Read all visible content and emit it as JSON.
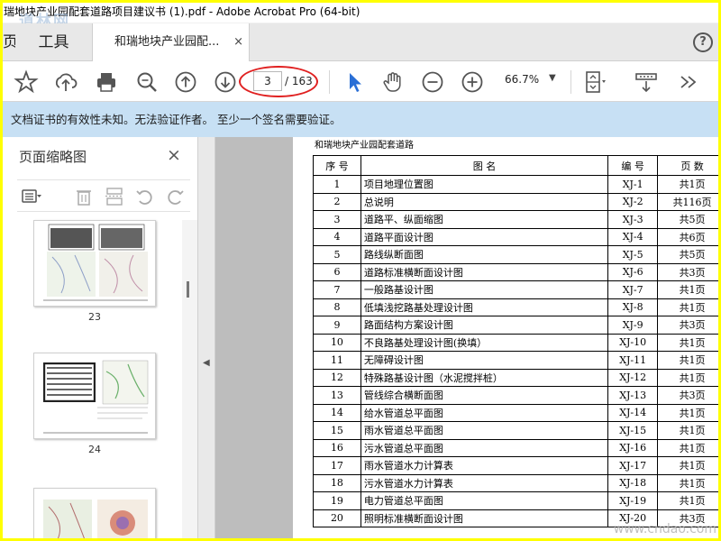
{
  "window": {
    "title": "瑞地块产业园配套道路项目建议书 (1).pdf - Adobe Acrobat Pro (64-bit)",
    "watermark": "道林网"
  },
  "tabs": {
    "stub_label": "页",
    "tools_label": "工具",
    "doc_tab_label": "和瑞地块产业园配...",
    "doc_tab_close": "×",
    "help": "?"
  },
  "toolbar": {
    "page_current": "3",
    "page_total": "/ 163",
    "zoom_value": "66.7%",
    "zoom_caret": "▼",
    "icons": [
      "star-icon",
      "upload-icon",
      "print-icon",
      "zoom-search-icon",
      "prev-page-icon",
      "next-page-icon",
      "select-arrow-icon",
      "hand-icon",
      "zoom-out-icon",
      "zoom-in-icon",
      "fit-page-icon",
      "scroll-mode-icon",
      "more-icon"
    ],
    "highlight_color": "#e02020"
  },
  "signature_bar": {
    "message": "文档证书的有效性未知。无法验证作者。 至少一个签名需要验证。",
    "background": "#c7e0f4"
  },
  "left_panel": {
    "title": "页面缩略图",
    "close": "×",
    "thumbnails": [
      {
        "label": "23"
      },
      {
        "label": "24"
      },
      {
        "label": ""
      }
    ]
  },
  "document": {
    "header": "和瑞地块产业园配套道路",
    "columns": [
      "序  号",
      "图                    名",
      "编  号",
      "页  数"
    ],
    "rows": [
      [
        "1",
        "项目地理位置图",
        "XJ-1",
        "共1页"
      ],
      [
        "2",
        "总说明",
        "XJ-2",
        "共116页"
      ],
      [
        "3",
        "道路平、纵面缩图",
        "XJ-3",
        "共5页"
      ],
      [
        "4",
        "道路平面设计图",
        "XJ-4",
        "共6页"
      ],
      [
        "5",
        "路线纵断面图",
        "XJ-5",
        "共5页"
      ],
      [
        "6",
        "道路标准横断面设计图",
        "XJ-6",
        "共3页"
      ],
      [
        "7",
        "一般路基设计图",
        "XJ-7",
        "共1页"
      ],
      [
        "8",
        "低填浅挖路基处理设计图",
        "XJ-8",
        "共1页"
      ],
      [
        "9",
        "路面结构方案设计图",
        "XJ-9",
        "共3页"
      ],
      [
        "10",
        "不良路基处理设计图(换填）",
        "XJ-10",
        "共1页"
      ],
      [
        "11",
        "无障碍设计图",
        "XJ-11",
        "共1页"
      ],
      [
        "12",
        "特殊路基设计图（水泥搅拌桩）",
        "XJ-12",
        "共1页"
      ],
      [
        "13",
        "管线综合横断面图",
        "XJ-13",
        "共3页"
      ],
      [
        "14",
        "给水管道总平面图",
        "XJ-14",
        "共1页"
      ],
      [
        "15",
        "雨水管道总平面图",
        "XJ-15",
        "共1页"
      ],
      [
        "16",
        "污水管道总平面图",
        "XJ-16",
        "共1页"
      ],
      [
        "17",
        "雨水管道水力计算表",
        "XJ-17",
        "共1页"
      ],
      [
        "18",
        "污水管道水力计算表",
        "XJ-18",
        "共1页"
      ],
      [
        "19",
        "电力管道总平面图",
        "XJ-19",
        "共1页"
      ],
      [
        "20",
        "照明标准横断面设计图",
        "XJ-20",
        "共3页"
      ]
    ],
    "bottom_watermark": "www.cndao.com"
  }
}
